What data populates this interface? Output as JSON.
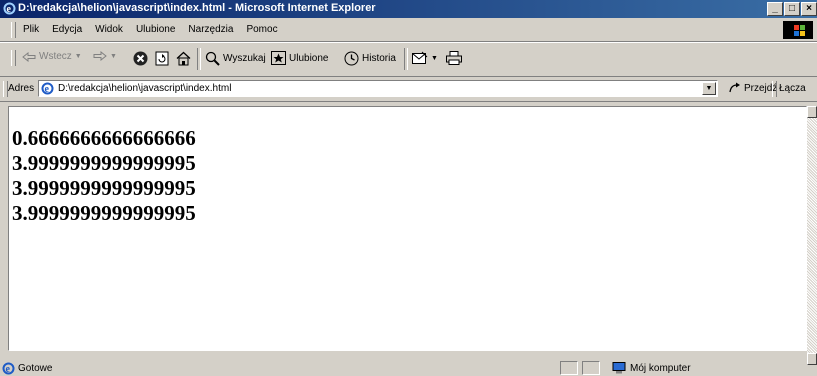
{
  "window": {
    "title": "D:\\redakcja\\helion\\javascript\\index.html - Microsoft Internet Explorer",
    "minimize": "_",
    "maximize": "□",
    "close": "×"
  },
  "menu": {
    "items": [
      "Plik",
      "Edycja",
      "Widok",
      "Ulubione",
      "Narzędzia",
      "Pomoc"
    ]
  },
  "toolbar": {
    "back_label": "Wstecz",
    "search_label": "Wyszukaj",
    "favorites_label": "Ulubione",
    "history_label": "Historia"
  },
  "address": {
    "label": "Adres",
    "value": "D:\\redakcja\\helion\\javascript\\index.html",
    "go_label": "Przejdź",
    "links_label": "Łącza"
  },
  "content": {
    "lines": [
      "0.6666666666666666",
      "3.9999999999999995",
      "3.9999999999999995",
      "3.9999999999999995"
    ]
  },
  "status": {
    "text": "Gotowe",
    "zone": "Mój komputer"
  }
}
